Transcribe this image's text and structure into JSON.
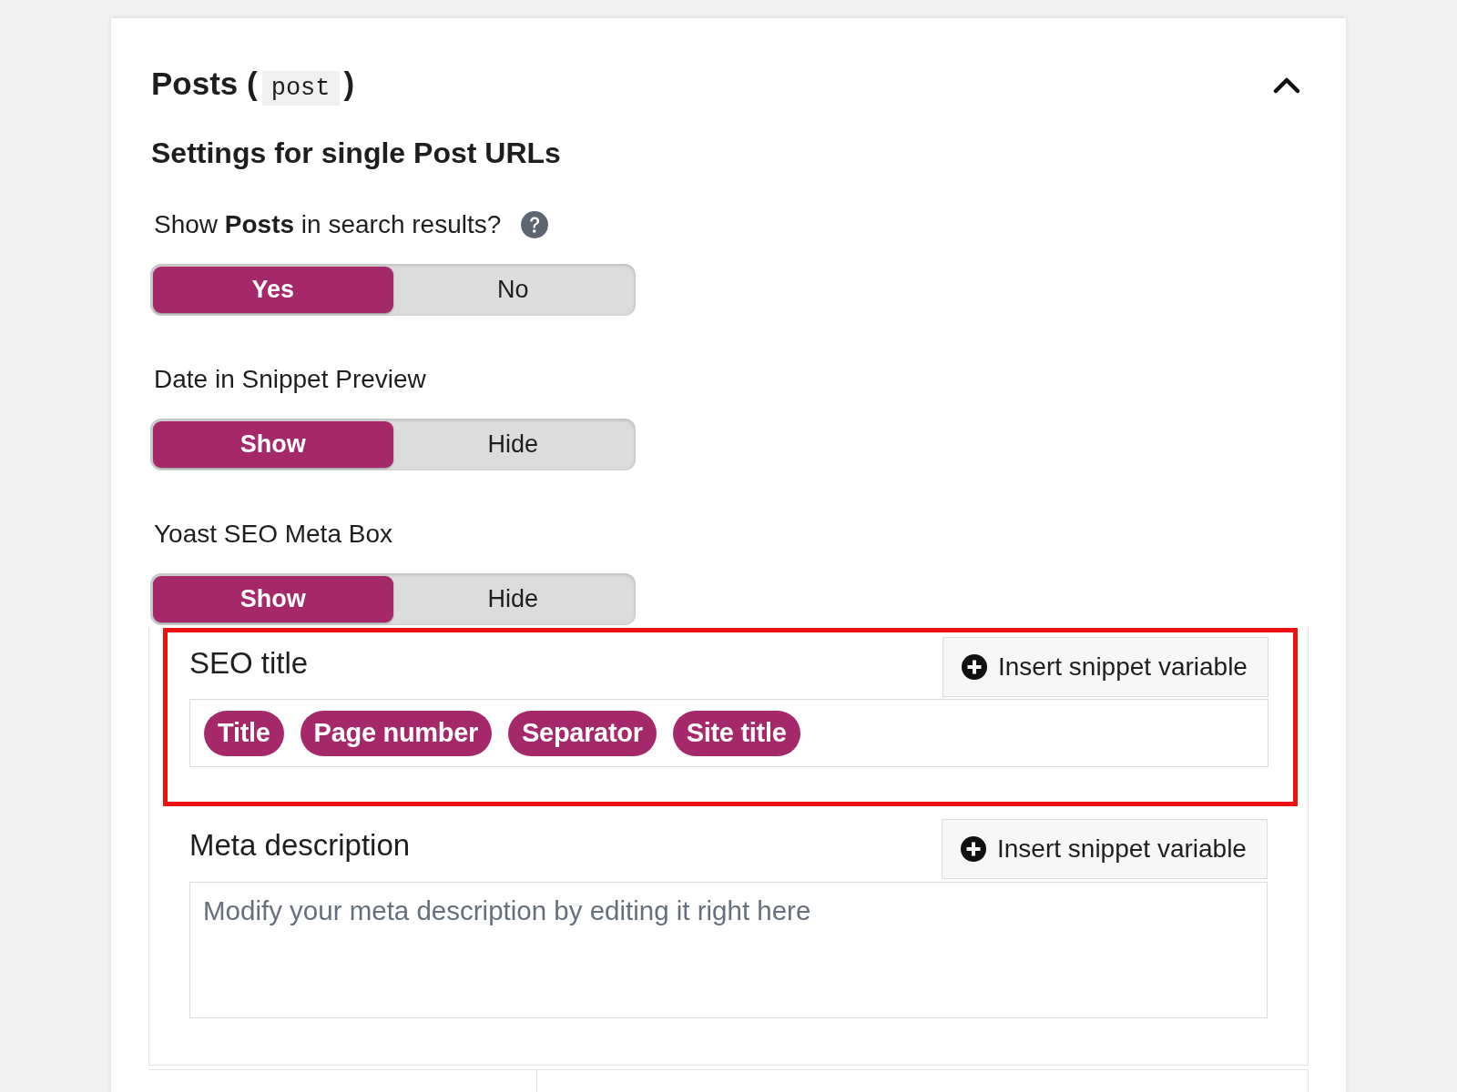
{
  "section": {
    "title_before": "Posts (",
    "post_type": "post",
    "title_after": ")",
    "expanded": true
  },
  "subtitle": "Settings for single Post URLs",
  "settings": [
    {
      "label": "Show **Posts** in search results?",
      "help": true,
      "options": [
        {
          "label": "Yes",
          "selected": true
        },
        {
          "label": "No",
          "selected": false
        }
      ]
    },
    {
      "label": "Date in Snippet Preview",
      "help": false,
      "options": [
        {
          "label": "Show",
          "selected": true
        },
        {
          "label": "Hide",
          "selected": false
        }
      ]
    },
    {
      "label": "Yoast SEO Meta Box",
      "help": false,
      "options": [
        {
          "label": "Show",
          "selected": true
        },
        {
          "label": "Hide",
          "selected": false
        }
      ]
    }
  ],
  "seo_title": {
    "label": "SEO title",
    "button": "Insert snippet variable",
    "highlighted": true,
    "variables": [
      "Title",
      "Page number",
      "Separator",
      "Site title"
    ]
  },
  "meta_description": {
    "label": "Meta description",
    "button": "Insert snippet variable",
    "placeholder": "Modify your meta description by editing it right here"
  }
}
